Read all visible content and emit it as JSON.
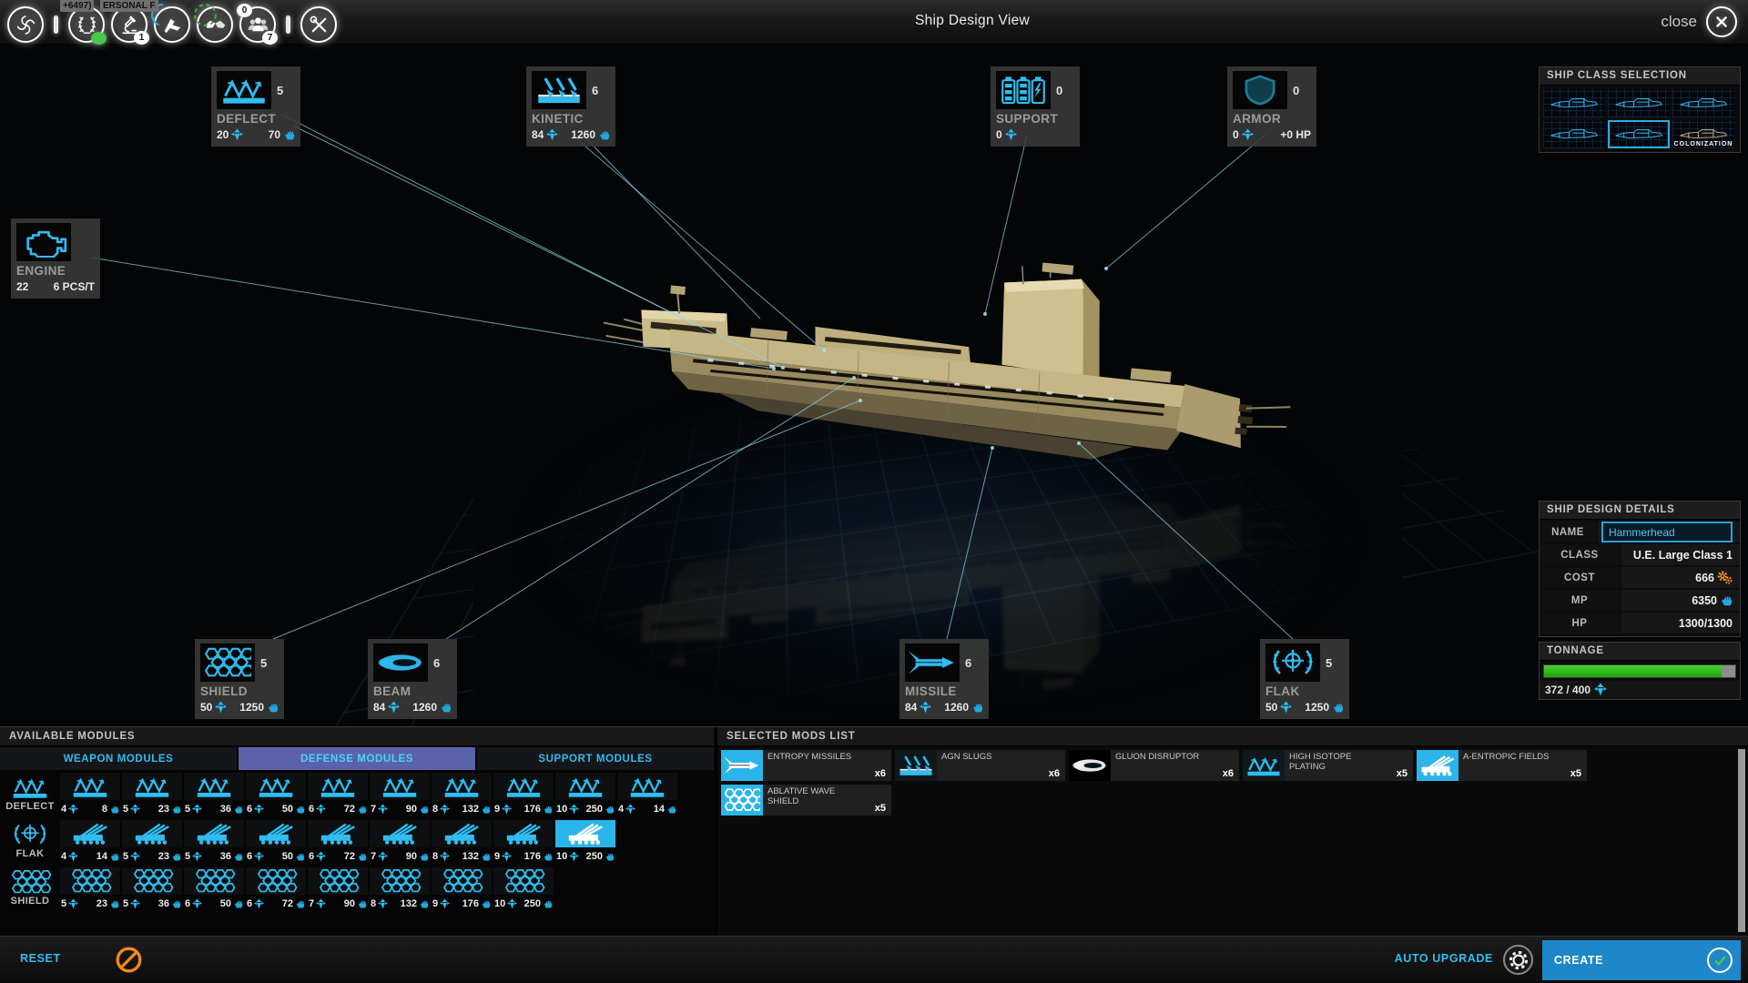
{
  "topbar": {
    "title": "Ship Design View",
    "close_label": "close",
    "tooltip_left": "+6497)",
    "tooltip_right": "ERSONAL F",
    "microscope_badge": "1",
    "people_badge_top": "0",
    "people_badge_bottom": "7"
  },
  "icons": {
    "close": "x-in-circle",
    "reset": "ban-circle",
    "auto_upgrade": "gear-circle",
    "create": "check-circle",
    "stat_tonnage": "tonnage-gem",
    "stat_power": "raised-fist",
    "cost": "orange-gears"
  },
  "callouts": [
    {
      "label": "DEFLECT",
      "count": "5",
      "s1": "20",
      "s2": "70"
    },
    {
      "label": "KINETIC",
      "count": "6",
      "s1": "84",
      "s2": "1260"
    },
    {
      "label": "SUPPORT",
      "count": "0",
      "s1": "0",
      "s2": ""
    },
    {
      "label": "ARMOR",
      "count": "0",
      "s1": "0",
      "s2": "+0 HP"
    },
    {
      "label": "ENGINE",
      "count": "",
      "s1": "22",
      "s2": "6 PCS/T"
    },
    {
      "label": "SHIELD",
      "count": "5",
      "s1": "50",
      "s2": "1250"
    },
    {
      "label": "BEAM",
      "count": "6",
      "s1": "84",
      "s2": "1260"
    },
    {
      "label": "MISSILE",
      "count": "6",
      "s1": "84",
      "s2": "1260"
    },
    {
      "label": "FLAK",
      "count": "5",
      "s1": "50",
      "s2": "1250"
    }
  ],
  "ship_class": {
    "header": "SHIP CLASS SELECTION",
    "items": [
      {},
      {},
      {},
      {},
      {
        "selected": true
      },
      {
        "label": "COLONIZATION",
        "variant": "tan"
      }
    ]
  },
  "details": {
    "header": "SHIP DESIGN DETAILS",
    "name_label": "NAME",
    "name_value": "Hammerhead",
    "class_label": "CLASS",
    "class_value": "U.E. Large Class 1",
    "cost_label": "COST",
    "cost_value": "666",
    "mp_label": "MP",
    "mp_value": "6350",
    "hp_label": "HP",
    "hp_value": "1300/1300"
  },
  "tonnage": {
    "header": "TONNAGE",
    "value": "372 / 400",
    "percent": 93
  },
  "modules": {
    "header": "AVAILABLE MODULES",
    "tabs": [
      {
        "label": "WEAPON MODULES"
      },
      {
        "label": "DEFENSE MODULES",
        "selected": true
      },
      {
        "label": "SUPPORT MODULES"
      }
    ],
    "row_deflect": {
      "label": "DEFLECT",
      "cells": [
        {
          "t": "4",
          "p": "8"
        },
        {
          "t": "5",
          "p": "23"
        },
        {
          "t": "5",
          "p": "36"
        },
        {
          "t": "6",
          "p": "50"
        },
        {
          "t": "6",
          "p": "72"
        },
        {
          "t": "7",
          "p": "90"
        },
        {
          "t": "8",
          "p": "132"
        },
        {
          "t": "9",
          "p": "176"
        },
        {
          "t": "10",
          "p": "250"
        },
        {
          "t": "4",
          "p": "14"
        }
      ]
    },
    "row_flak": {
      "label": "FLAK",
      "cells": [
        {
          "t": "4",
          "p": "14"
        },
        {
          "t": "5",
          "p": "23"
        },
        {
          "t": "5",
          "p": "36"
        },
        {
          "t": "6",
          "p": "50"
        },
        {
          "t": "6",
          "p": "72"
        },
        {
          "t": "7",
          "p": "90"
        },
        {
          "t": "8",
          "p": "132"
        },
        {
          "t": "9",
          "p": "176"
        },
        {
          "t": "10",
          "p": "250",
          "selected": true
        }
      ]
    },
    "row_shield": {
      "label": "SHIELD",
      "cells": [
        {
          "t": "5",
          "p": "23"
        },
        {
          "t": "5",
          "p": "36"
        },
        {
          "t": "6",
          "p": "50"
        },
        {
          "t": "6",
          "p": "72"
        },
        {
          "t": "7",
          "p": "90"
        },
        {
          "t": "8",
          "p": "132"
        },
        {
          "t": "9",
          "p": "176"
        },
        {
          "t": "10",
          "p": "250"
        }
      ]
    }
  },
  "mods_list": {
    "header": "SELECTED MODS LIST",
    "items": [
      {
        "name": "ENTROPY MISSILES",
        "count": "x6",
        "icon": "missile",
        "tile": "cyan"
      },
      {
        "name": "AGN SLUGS",
        "count": "x6",
        "icon": "kinetic",
        "tile": "dark"
      },
      {
        "name": "GLUON DISRUPTOR",
        "count": "x6",
        "icon": "beam",
        "tile": "black"
      },
      {
        "name": "HIGH ISOTOPE PLATING",
        "count": "x5",
        "icon": "deflect",
        "tile": "dark"
      },
      {
        "name": "A-ENTROPIC FIELDS",
        "count": "x5",
        "icon": "flaktruck",
        "tile": "cyan"
      },
      {
        "name": "ABLATIVE WAVE SHIELD",
        "count": "x5",
        "icon": "honeycomb",
        "tile": "cyan"
      }
    ]
  },
  "footer": {
    "reset": "RESET",
    "auto_upgrade": "AUTO UPGRADE",
    "create": "CREATE"
  },
  "colors": {
    "accent": "#2fbdf0",
    "tab_active": "#5b61ab",
    "create_bg": "#1e87c9",
    "tonnage_green": "#2fb31c",
    "cost_orange": "#f08a1e"
  }
}
